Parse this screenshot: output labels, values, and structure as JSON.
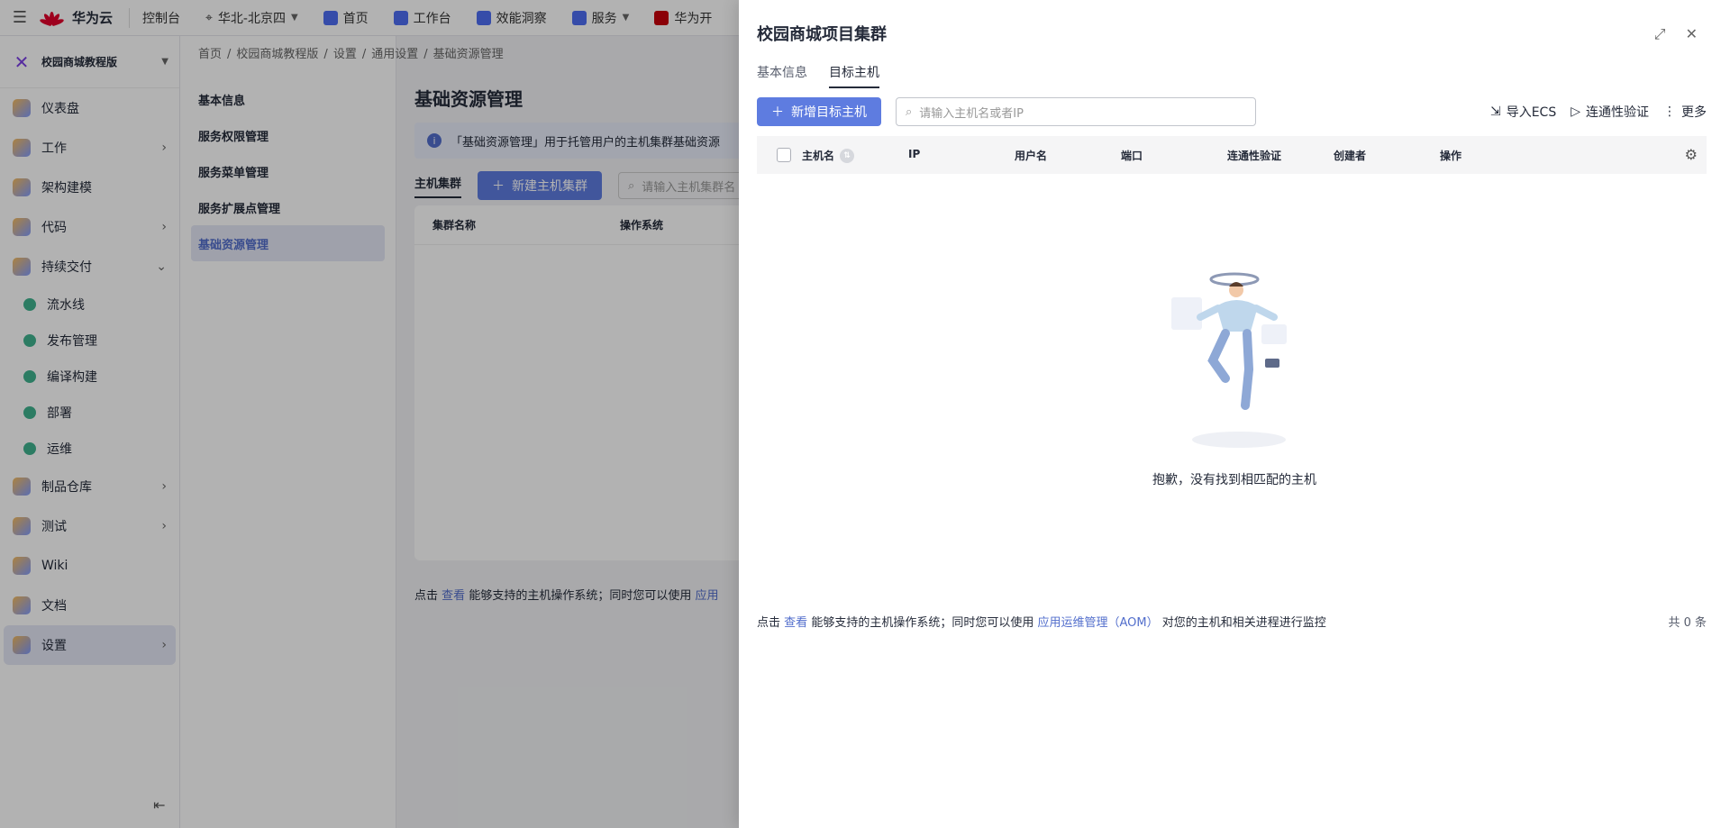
{
  "topbar": {
    "brand": "华为云",
    "console": "控制台",
    "region": "华北-北京四",
    "nav": [
      "首页",
      "工作台",
      "效能洞察",
      "服务",
      "华为开"
    ]
  },
  "sidebar": {
    "project": "校园商城教程版",
    "items": [
      {
        "label": "仪表盘",
        "arrow": false
      },
      {
        "label": "工作",
        "arrow": true
      },
      {
        "label": "架构建模",
        "arrow": false
      },
      {
        "label": "代码",
        "arrow": true
      },
      {
        "label": "持续交付",
        "arrow": true
      }
    ],
    "sub_items": [
      "流水线",
      "发布管理",
      "编译构建",
      "部署",
      "运维"
    ],
    "items2": [
      {
        "label": "制品仓库",
        "arrow": true
      },
      {
        "label": "测试",
        "arrow": true
      },
      {
        "label": "Wiki",
        "arrow": false
      },
      {
        "label": "文档",
        "arrow": false
      },
      {
        "label": "设置",
        "arrow": true
      }
    ]
  },
  "breadcrumb": [
    "首页",
    "/",
    "校园商城教程版",
    "/",
    "设置",
    "/",
    "通用设置",
    "/",
    "基础资源管理"
  ],
  "subnav": [
    "基本信息",
    "服务权限管理",
    "服务菜单管理",
    "服务扩展点管理",
    "基础资源管理"
  ],
  "main": {
    "title": "基础资源管理",
    "tip": "「基础资源管理」用于托管用户的主机集群基础资源",
    "tab": "主机集群",
    "new_btn": "新建主机集群",
    "search_placeholder": "请输入主机集群名",
    "col1": "集群名称",
    "col2": "操作系统",
    "foot_a": "点击",
    "foot_link": "查看",
    "foot_b": "能够支持的主机操作系统；同时您可以使用",
    "foot_link2": "应用"
  },
  "drawer": {
    "title": "校园商城项目集群",
    "tabs": [
      "基本信息",
      "目标主机"
    ],
    "add_btn": "新增目标主机",
    "search_placeholder": "请输入主机名或者IP",
    "actions": [
      "导入ECS",
      "连通性验证",
      "更多"
    ],
    "columns": [
      "主机名",
      "IP",
      "用户名",
      "端口",
      "连通性验证",
      "创建者",
      "操作"
    ],
    "empty_text": "抱歉，没有找到相匹配的主机",
    "foot": {
      "a": "点击",
      "link1": "查看",
      "b": "能够支持的主机操作系统；同时您可以使用",
      "link2": "应用运维管理（AOM）",
      "c": "对您的主机和相关进程进行监控",
      "total": "共 0 条"
    }
  }
}
